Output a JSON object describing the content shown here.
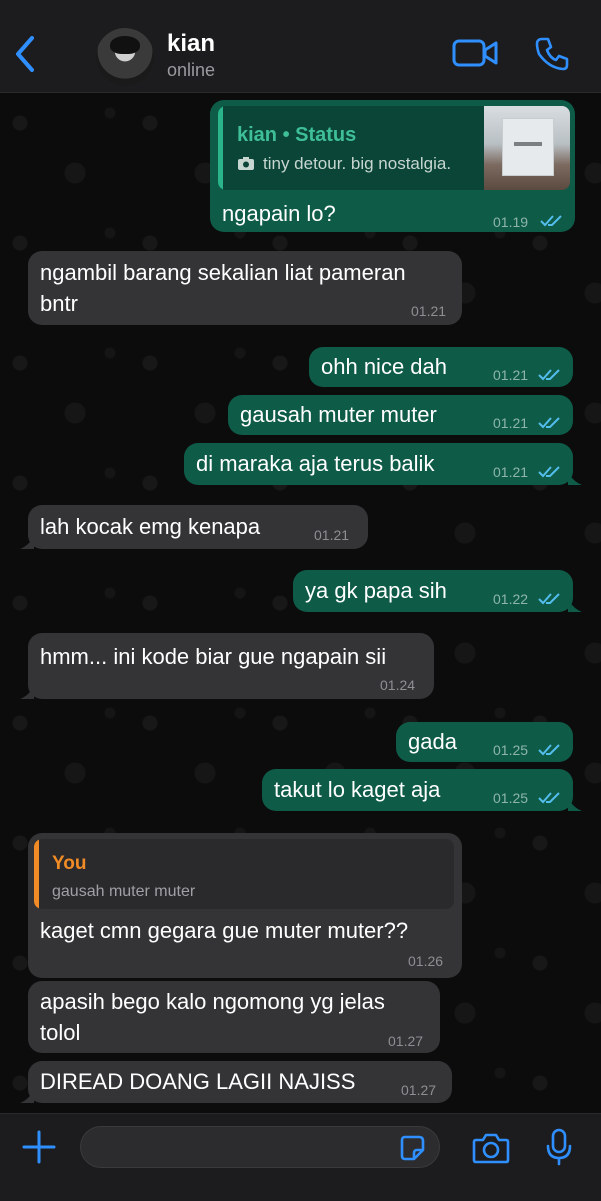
{
  "header": {
    "contact_name": "kian",
    "contact_status": "online"
  },
  "messages": [
    {
      "dir": "out",
      "text": "ngapain lo?",
      "time": "01.19",
      "quote": {
        "title": "kian • Status",
        "text": "tiny detour. big nostalgia."
      }
    },
    {
      "dir": "in",
      "text": [
        "ngambil barang sekalian liat pameran",
        "bntr"
      ],
      "time": "01.21"
    },
    {
      "dir": "out",
      "text": "ohh nice dah",
      "time": "01.21"
    },
    {
      "dir": "out",
      "text": "gausah muter muter",
      "time": "01.21"
    },
    {
      "dir": "out",
      "text": "di maraka aja terus balik",
      "time": "01.21"
    },
    {
      "dir": "in",
      "text": "lah kocak emg kenapa",
      "time": "01.21"
    },
    {
      "dir": "out",
      "text": "ya gk papa sih",
      "time": "01.22"
    },
    {
      "dir": "in",
      "text": "hmm... ini kode biar gue ngapain sii",
      "time": "01.24"
    },
    {
      "dir": "out",
      "text": "gada",
      "time": "01.25"
    },
    {
      "dir": "out",
      "text": "takut lo kaget aja",
      "time": "01.25"
    },
    {
      "dir": "in",
      "text": "kaget cmn gegara gue muter muter??",
      "time": "01.26",
      "quote": {
        "title": "You",
        "text": "gausah muter muter"
      }
    },
    {
      "dir": "in",
      "text": [
        "apasih bego kalo ngomong yg jelas",
        "tolol"
      ],
      "time": "01.27"
    },
    {
      "dir": "in",
      "text": "DIREAD DOANG LAGII NAJISS",
      "time": "01.27"
    }
  ],
  "input": {
    "value": "",
    "placeholder": ""
  },
  "icons": {
    "back": "chevron-left-icon",
    "video": "video-camera-icon",
    "call": "phone-icon",
    "plus": "plus-icon",
    "sticker": "sticker-icon",
    "camera": "camera-icon",
    "mic": "microphone-icon",
    "read": "double-check-icon"
  },
  "colors": {
    "accent": "#2f8fff",
    "outgoing_bubble": "#0e5b48",
    "incoming_bubble": "#343437",
    "read_ticks": "#53bdeb",
    "status_quote_title": "#3fbf97",
    "you_quote_title": "#f08b25"
  }
}
